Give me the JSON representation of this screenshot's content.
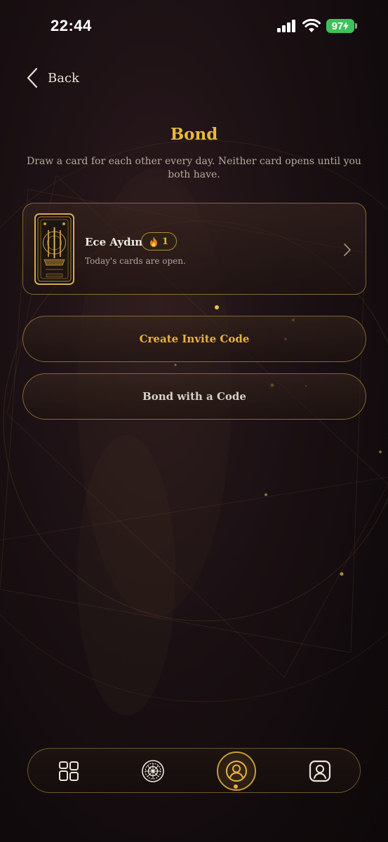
{
  "status_bar": {
    "time": "22:44",
    "battery": "97"
  },
  "nav": {
    "back_label": "Back"
  },
  "header": {
    "title": "Bond",
    "subtitle": "Draw a card for each other every day. Neither card opens until you both have."
  },
  "bond": {
    "partner_name": "Ece Aydın",
    "streak_count": "1",
    "status": "Today's cards are open."
  },
  "actions": {
    "create_invite_label": "Create Invite Code",
    "bond_with_code_label": "Bond with a Code"
  },
  "tabbar": {
    "tabs": [
      {
        "icon": "grid-icon",
        "active": false
      },
      {
        "icon": "mandala-icon",
        "active": false
      },
      {
        "icon": "person-circle-icon",
        "active": true
      },
      {
        "icon": "profile-square-icon",
        "active": false
      }
    ]
  },
  "colors": {
    "accent": "#e6b43e",
    "border": "#c99a38",
    "background": "#160e10"
  }
}
